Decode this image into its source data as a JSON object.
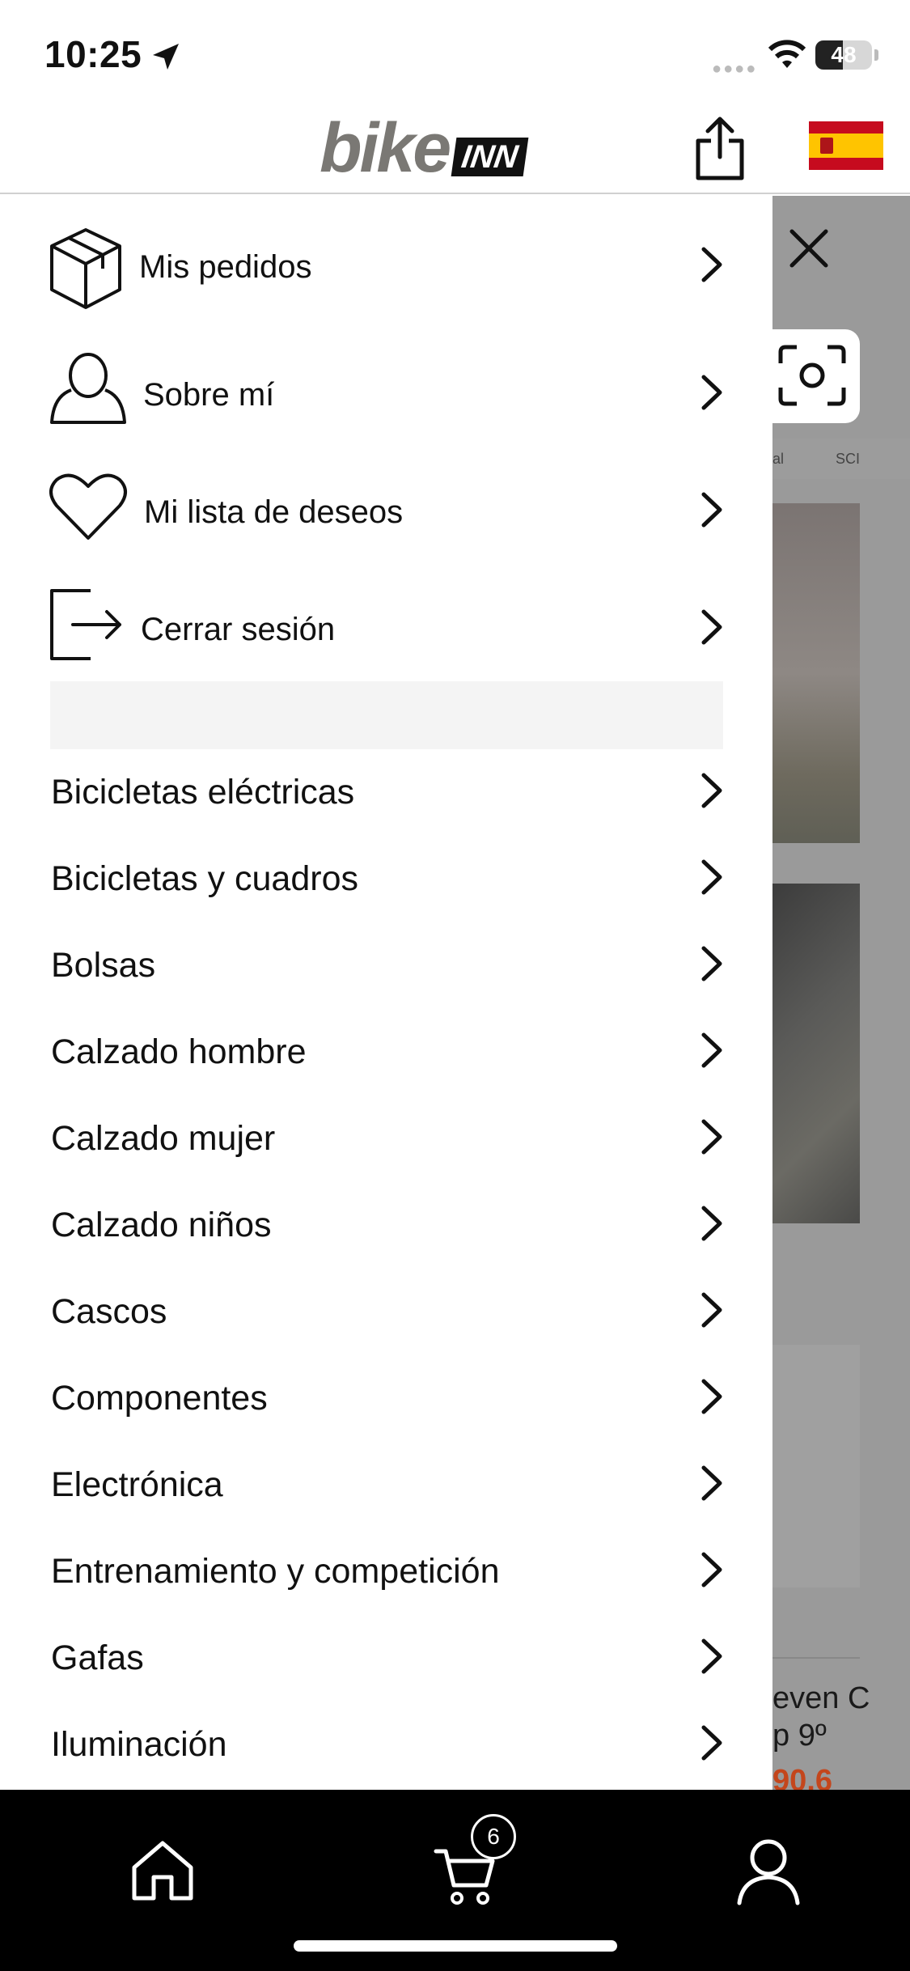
{
  "status_bar": {
    "time": "10:25",
    "battery": "48"
  },
  "header": {
    "logo_bike": "bike",
    "logo_inn": "INN",
    "share_icon": "share-icon",
    "flag_icon": "spain-flag-icon"
  },
  "drawer": {
    "account_items": [
      {
        "label": "Mis pedidos",
        "icon": "package-icon"
      },
      {
        "label": "Sobre mí",
        "icon": "user-icon"
      },
      {
        "label": "Mi lista de deseos",
        "icon": "heart-icon"
      },
      {
        "label": "Cerrar sesión",
        "icon": "logout-icon"
      }
    ],
    "categories": [
      "Bicicletas eléctricas",
      "Bicicletas y cuadros",
      "Bolsas",
      "Calzado hombre",
      "Calzado mujer",
      "Calzado niños",
      "Cascos",
      "Componentes",
      "Electrónica",
      "Entrenamiento y competición",
      "Gafas",
      "Iluminación"
    ]
  },
  "background_page": {
    "brand_1": "al",
    "brand_2": "SCI",
    "product_line_1": "even C",
    "product_line_2": "p 9º",
    "product_price": "90,6"
  },
  "bottom_bar": {
    "tabs": [
      {
        "icon": "home-icon"
      },
      {
        "icon": "cart-icon"
      },
      {
        "icon": "account-icon"
      }
    ],
    "cart_count": "6"
  },
  "colors": {
    "logo_gray": "#7a7874",
    "price_orange": "#c4461c",
    "bottom_bar_bg": "#000000"
  }
}
